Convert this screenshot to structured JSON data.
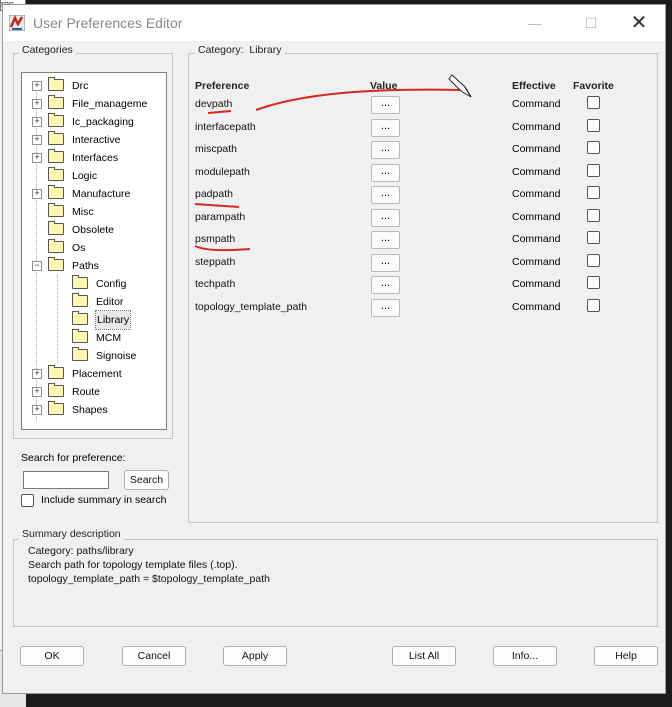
{
  "background_window": {
    "tab_label": "ron"
  },
  "window": {
    "title": "User Preferences Editor",
    "minimize": "—",
    "maximize": "☐",
    "close": "✕"
  },
  "categories": {
    "label": "Categories",
    "tree": [
      {
        "label": "Drc",
        "expander": "+"
      },
      {
        "label": "File_manageme",
        "expander": "+"
      },
      {
        "label": "Ic_packaging",
        "expander": "+"
      },
      {
        "label": "Interactive",
        "expander": "+"
      },
      {
        "label": "Interfaces",
        "expander": "+"
      },
      {
        "label": "Logic",
        "expander": ""
      },
      {
        "label": "Manufacture",
        "expander": "+"
      },
      {
        "label": "Misc",
        "expander": ""
      },
      {
        "label": "Obsolete",
        "expander": ""
      },
      {
        "label": "Os",
        "expander": ""
      },
      {
        "label": "Paths",
        "expander": "−"
      },
      {
        "label": "Config",
        "expander": ""
      },
      {
        "label": "Editor",
        "expander": ""
      },
      {
        "label": "Library",
        "expander": "",
        "selected": true
      },
      {
        "label": "MCM",
        "expander": ""
      },
      {
        "label": "Signoise",
        "expander": ""
      },
      {
        "label": "Placement",
        "expander": "+"
      },
      {
        "label": "Route",
        "expander": "+"
      },
      {
        "label": "Shapes",
        "expander": "+"
      }
    ]
  },
  "search": {
    "label": "Search for preference:",
    "value": "",
    "button": "Search",
    "include_summary": "Include summary in search",
    "include_summary_checked": false
  },
  "category_panel": {
    "label": "Category:",
    "value": "Library",
    "headers": {
      "preference": "Preference",
      "value": "Value",
      "effective": "Effective",
      "favorite": "Favorite"
    },
    "rows": [
      {
        "name": "devpath",
        "button": "...",
        "effective": "Command",
        "favorite": false
      },
      {
        "name": "interfacepath",
        "button": "...",
        "effective": "Command",
        "favorite": false
      },
      {
        "name": "miscpath",
        "button": "...",
        "effective": "Command",
        "favorite": false
      },
      {
        "name": "modulepath",
        "button": "...",
        "effective": "Command",
        "favorite": false
      },
      {
        "name": "padpath",
        "button": "...",
        "effective": "Command",
        "favorite": false
      },
      {
        "name": "parampath",
        "button": "...",
        "effective": "Command",
        "favorite": false
      },
      {
        "name": "psmpath",
        "button": "...",
        "effective": "Command",
        "favorite": false
      },
      {
        "name": "steppath",
        "button": "...",
        "effective": "Command",
        "favorite": false
      },
      {
        "name": "techpath",
        "button": "...",
        "effective": "Command",
        "favorite": false
      },
      {
        "name": "topology_template_path",
        "button": "...",
        "effective": "Command",
        "favorite": false
      }
    ]
  },
  "summary": {
    "label": "Summary description",
    "lines": [
      "Category: paths/library",
      "Search path for topology template files (.top).",
      "topology_template_path = $topology_template_path"
    ]
  },
  "buttons": {
    "ok": "OK",
    "cancel": "Cancel",
    "apply": "Apply",
    "list_all": "List All",
    "info": "Info...",
    "help": "Help"
  },
  "colors": {
    "annotation_red": "#d6281f",
    "folder_yellow": "#fff7b0",
    "dialog_bg": "#f0f0f0"
  }
}
